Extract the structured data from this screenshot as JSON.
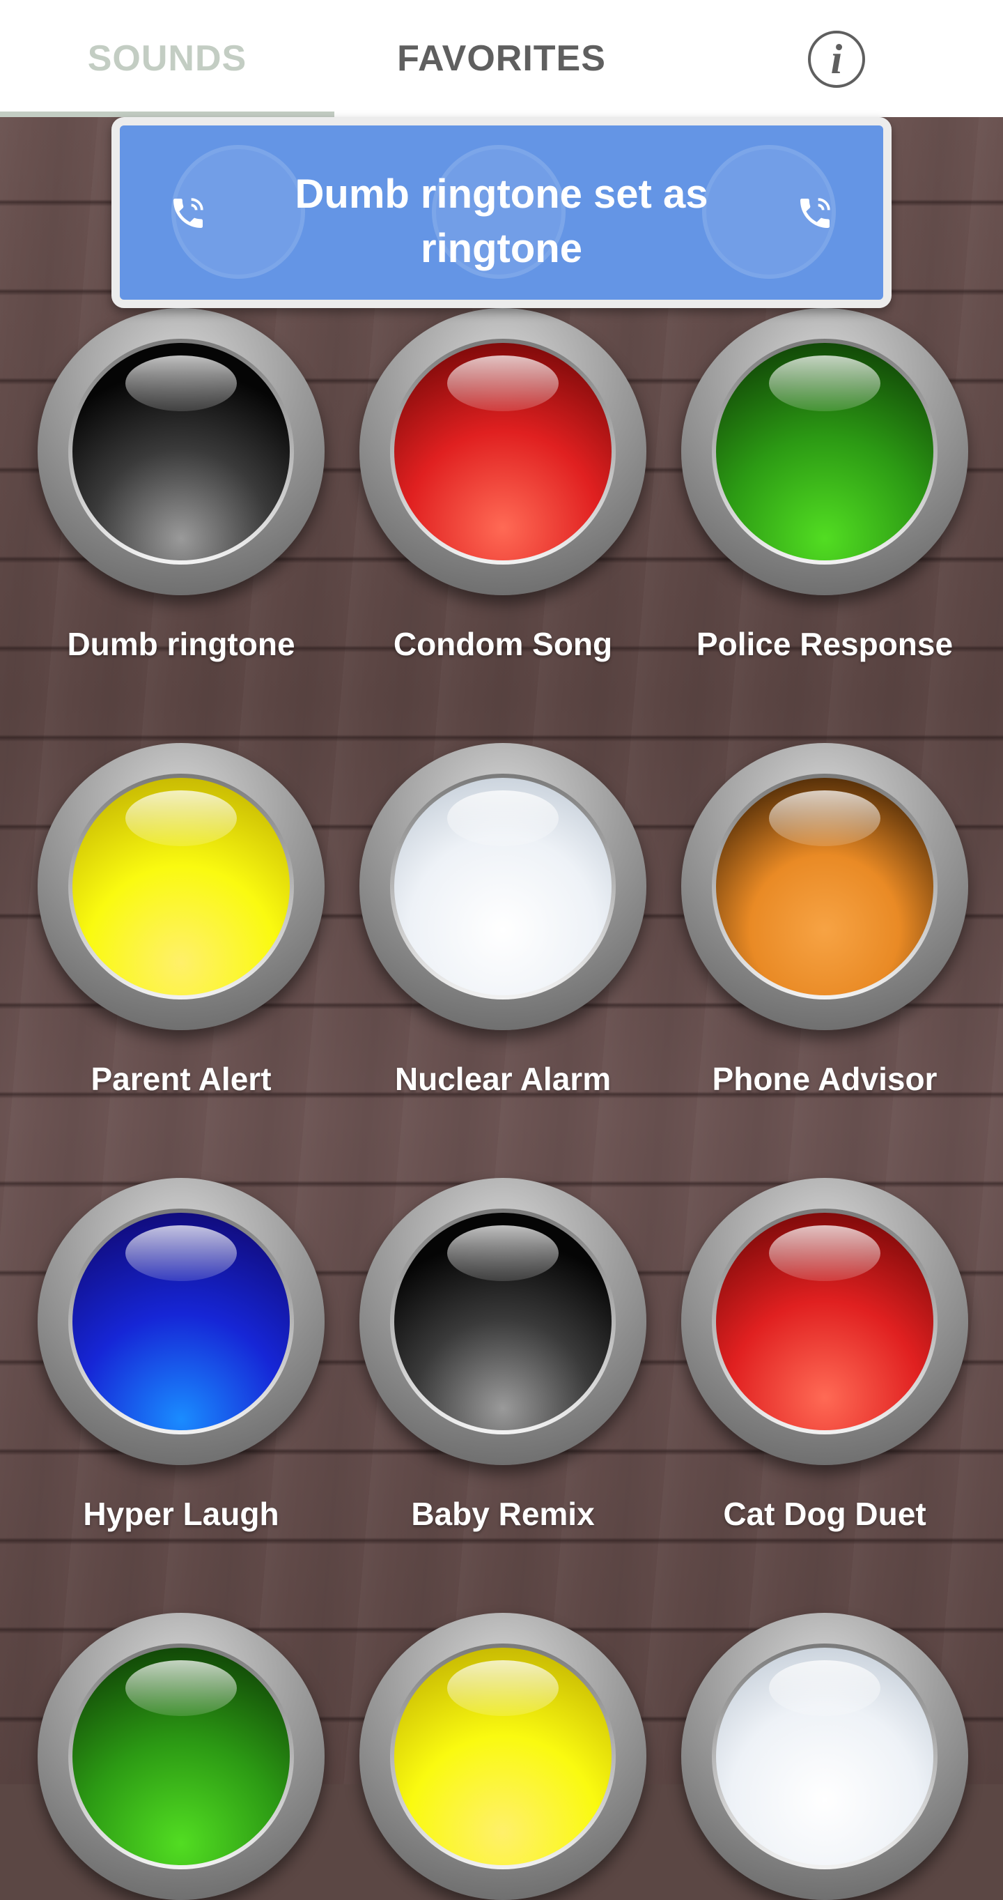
{
  "tabs": [
    {
      "label": "SOUNDS",
      "selected": true
    },
    {
      "label": "FAVORITES",
      "selected": false
    }
  ],
  "header": {
    "info_icon": "info-icon",
    "info_glyph": "i"
  },
  "toast": {
    "message": "Dumb ringtone set as ringtone",
    "icon": "phone-ringing-icon",
    "background": "#6495e5"
  },
  "sounds": [
    {
      "label": "Dumb ringtone",
      "color": "black"
    },
    {
      "label": "Condom Song",
      "color": "red"
    },
    {
      "label": "Police Response",
      "color": "green"
    },
    {
      "label": "Parent Alert",
      "color": "yellow"
    },
    {
      "label": "Nuclear Alarm",
      "color": "white"
    },
    {
      "label": "Phone Advisor",
      "color": "orange"
    },
    {
      "label": "Hyper Laugh",
      "color": "blue"
    },
    {
      "label": "Baby Remix",
      "color": "black"
    },
    {
      "label": "Cat Dog Duet",
      "color": "red"
    },
    {
      "label": "",
      "color": "green"
    },
    {
      "label": "",
      "color": "yellow"
    },
    {
      "label": "",
      "color": "white"
    }
  ],
  "colors": {
    "tab_selected": "#c3cdc3",
    "tab_unselected": "#5f5f5f"
  }
}
